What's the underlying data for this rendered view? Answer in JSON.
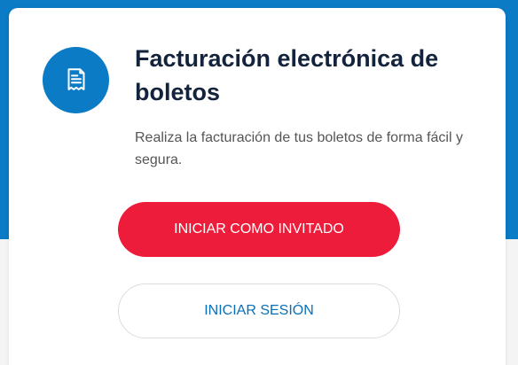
{
  "colors": {
    "brand_blue": "#0a7bc4",
    "title_navy": "#14233c",
    "primary_red": "#ec1c3a",
    "link_blue": "#0a6fb5"
  },
  "card": {
    "icon": "receipt-document-icon",
    "title": "Facturación electrónica de boletos",
    "description": "Realiza la facturación de tus boletos de forma fácil y segura.",
    "guest_button_label": "INICIAR COMO INVITADO",
    "login_button_label": "INICIAR SESIÓN"
  }
}
